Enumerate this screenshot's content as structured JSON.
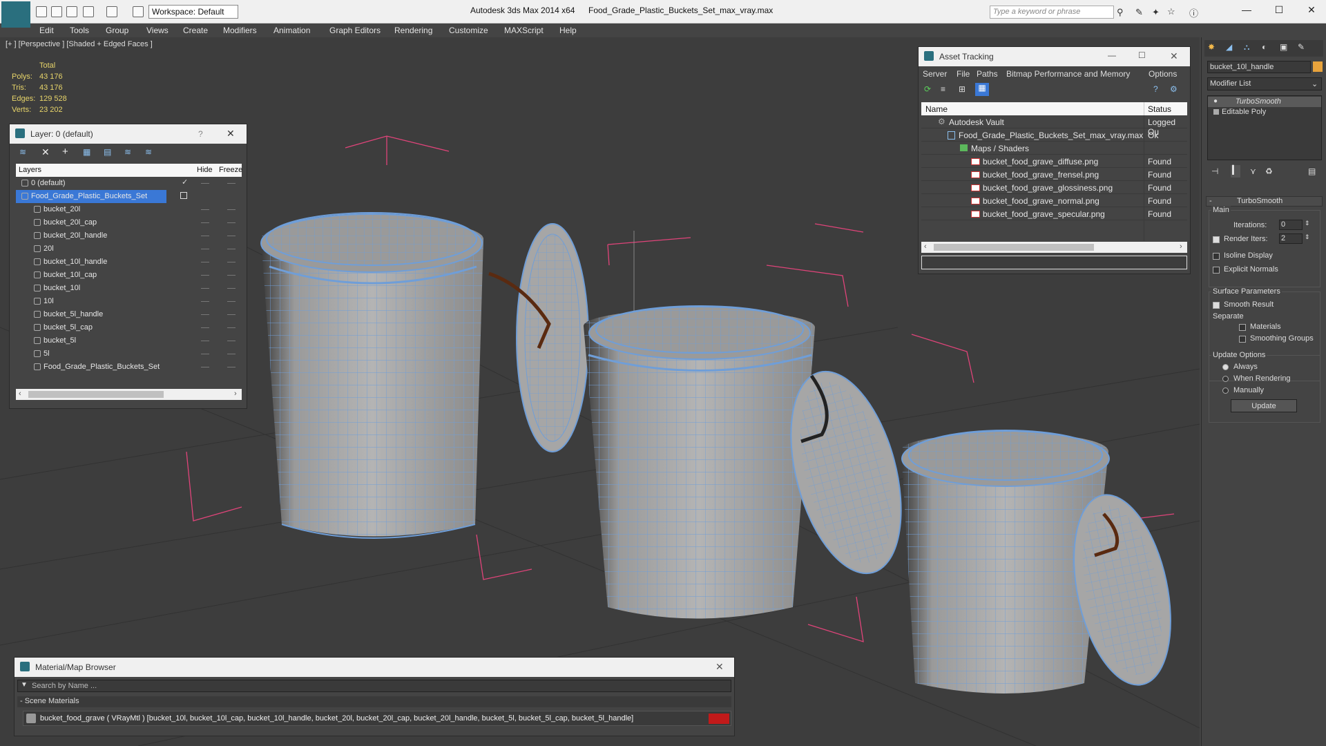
{
  "titlebar": {
    "app_title": "Autodesk 3ds Max  2014 x64",
    "file_name": "Food_Grade_Plastic_Buckets_Set_max_vray.max",
    "workspace": "Workspace: Default",
    "search_placeholder": "Type a keyword or phrase"
  },
  "menu": [
    "Edit",
    "Tools",
    "Group",
    "Views",
    "Create",
    "Modifiers",
    "Animation",
    "Graph Editors",
    "Rendering",
    "Customize",
    "MAXScript",
    "Help"
  ],
  "viewport": {
    "label": "[+ ] [Perspective ] [Shaded + Edged Faces ]",
    "stats_header": "Total",
    "stats": [
      {
        "k": "Polys:",
        "v": "43 176"
      },
      {
        "k": "Tris:",
        "v": "43 176"
      },
      {
        "k": "Edges:",
        "v": "129 528"
      },
      {
        "k": "Verts:",
        "v": "23 202"
      }
    ]
  },
  "layer_panel": {
    "title": "Layer: 0 (default)",
    "help": "?",
    "columns": {
      "layers": "Layers",
      "hide": "Hide",
      "freeze": "Freeze"
    },
    "rows": [
      {
        "name": "0 (default)",
        "indent": 0
      },
      {
        "name": "Food_Grade_Plastic_Buckets_Set",
        "indent": 0,
        "selected": true
      },
      {
        "name": "bucket_20l",
        "indent": 1
      },
      {
        "name": "bucket_20l_cap",
        "indent": 1
      },
      {
        "name": "bucket_20l_handle",
        "indent": 1
      },
      {
        "name": "20l",
        "indent": 1
      },
      {
        "name": "bucket_10l_handle",
        "indent": 1
      },
      {
        "name": "bucket_10l_cap",
        "indent": 1
      },
      {
        "name": "bucket_10l",
        "indent": 1
      },
      {
        "name": "10l",
        "indent": 1
      },
      {
        "name": "bucket_5l_handle",
        "indent": 1
      },
      {
        "name": "bucket_5l_cap",
        "indent": 1
      },
      {
        "name": "bucket_5l",
        "indent": 1
      },
      {
        "name": "5l",
        "indent": 1
      },
      {
        "name": "Food_Grade_Plastic_Buckets_Set",
        "indent": 1
      }
    ]
  },
  "asset_panel": {
    "title": "Asset Tracking",
    "menu": [
      "Server",
      "File",
      "Paths",
      "Bitmap Performance and Memory",
      "Options"
    ],
    "columns": {
      "name": "Name",
      "status": "Status"
    },
    "rows": [
      {
        "name": "Autodesk Vault",
        "status": "Logged Ou",
        "indent": 1,
        "type": "vault"
      },
      {
        "name": "Food_Grade_Plastic_Buckets_Set_max_vray.max",
        "status": "Ok",
        "indent": 2,
        "type": "max"
      },
      {
        "name": "Maps / Shaders",
        "status": "",
        "indent": 3,
        "type": "maps"
      },
      {
        "name": "bucket_food_grave_diffuse.png",
        "status": "Found",
        "indent": 4,
        "type": "png"
      },
      {
        "name": "bucket_food_grave_frensel.png",
        "status": "Found",
        "indent": 4,
        "type": "png"
      },
      {
        "name": "bucket_food_grave_glossiness.png",
        "status": "Found",
        "indent": 4,
        "type": "png"
      },
      {
        "name": "bucket_food_grave_normal.png",
        "status": "Found",
        "indent": 4,
        "type": "png"
      },
      {
        "name": "bucket_food_grave_specular.png",
        "status": "Found",
        "indent": 4,
        "type": "png"
      }
    ]
  },
  "command_panel": {
    "object_name": "bucket_10l_handle",
    "modifier_list": "Modifier List",
    "stack": [
      "TurboSmooth",
      "Editable Poly"
    ],
    "rollout": "TurboSmooth",
    "main_label": "Main",
    "iterations_label": "Iterations:",
    "iterations_value": "0",
    "render_iters_label": "Render Iters:",
    "render_iters_value": "2",
    "isoline": "Isoline Display",
    "explicit_normals": "Explicit Normals",
    "surface_params": "Surface Parameters",
    "smooth_result": "Smooth Result",
    "separate": "Separate",
    "materials": "Materials",
    "smoothing_groups": "Smoothing Groups",
    "update_options": "Update Options",
    "always": "Always",
    "when_rendering": "When Rendering",
    "manually": "Manually",
    "update_button": "Update"
  },
  "material_browser": {
    "title": "Material/Map Browser",
    "search_placeholder": "Search by Name ...",
    "group": "- Scene Materials",
    "material": "bucket_food_grave  ( VRayMtl )  [bucket_10l, bucket_10l_cap, bucket_10l_handle, bucket_20l, bucket_20l_cap, bucket_20l_handle, bucket_5l, bucket_5l_cap, bucket_5l_handle]"
  },
  "colors": {
    "accent": "#2a6f7e",
    "selection": "#3a78d6",
    "wire": "#6f9ed8",
    "stats": "#e8d56a",
    "grid": "#e0447a"
  }
}
